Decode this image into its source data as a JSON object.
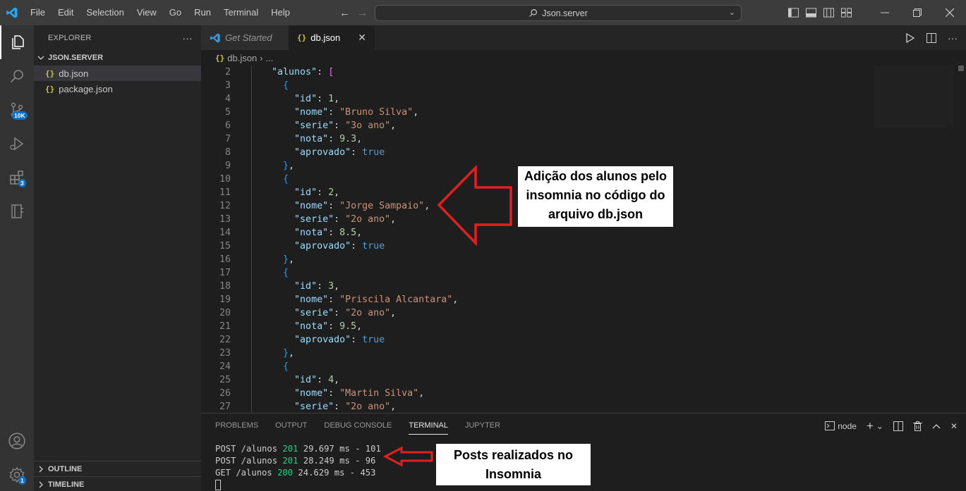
{
  "menu": [
    "File",
    "Edit",
    "Selection",
    "View",
    "Go",
    "Run",
    "Terminal",
    "Help"
  ],
  "command_center": "Json.server",
  "activity": {
    "source_control_badge": "10K",
    "extensions_badge": "3",
    "settings_badge": "1"
  },
  "sidebar": {
    "title": "EXPLORER",
    "more": "···",
    "folder": "JSON.SERVER",
    "files": [
      "db.json",
      "package.json"
    ],
    "outline": "OUTLINE",
    "timeline": "TIMELINE"
  },
  "tabs": {
    "get_started": "Get Started",
    "active": "db.json"
  },
  "breadcrumb": {
    "file": "db.json",
    "rest": "..."
  },
  "code": {
    "line_numbers": [
      "2",
      "3",
      "4",
      "5",
      "6",
      "7",
      "8",
      "9",
      "10",
      "11",
      "12",
      "13",
      "14",
      "15",
      "16",
      "17",
      "18",
      "19",
      "20",
      "21",
      "22",
      "23",
      "24",
      "25",
      "26",
      "27"
    ],
    "students": [
      {
        "id": "1",
        "nome": "\"Bruno Silva\"",
        "serie": "\"3o ano\"",
        "nota": "9.3",
        "aprovado": "true"
      },
      {
        "id": "2",
        "nome": "\"Jorge Sampaio\"",
        "serie": "\"2o ano\"",
        "nota": "8.5",
        "aprovado": "true"
      },
      {
        "id": "3",
        "nome": "\"Priscila Alcantara\"",
        "serie": "\"2o ano\"",
        "nota": "9.5",
        "aprovado": "true"
      },
      {
        "id": "4",
        "nome": "\"Martin Silva\"",
        "serie": "\"2o ano\""
      }
    ]
  },
  "callouts": {
    "top": [
      "Adição dos alunos pelo",
      "insomnia no código do",
      "arquivo db.json"
    ],
    "bottom": [
      "Posts realizados no",
      "Insomnia"
    ]
  },
  "panel": {
    "tabs": [
      "PROBLEMS",
      "OUTPUT",
      "DEBUG CONSOLE",
      "TERMINAL",
      "JUPYTER"
    ],
    "active_tab": "TERMINAL",
    "shell": "node"
  },
  "terminal": [
    {
      "pre": "POST /alunos ",
      "status": "201",
      "post": " 29.697 ms - 101"
    },
    {
      "pre": "POST /alunos ",
      "status": "201",
      "post": " 28.249 ms - 96"
    },
    {
      "pre": "GET /alunos ",
      "status": "200",
      "post": " 24.629 ms - 453"
    }
  ],
  "colors": {
    "accent": "#0e70c0",
    "arrow": "#e02020",
    "string": "#ce9178",
    "key": "#9cdcfe",
    "status_ok": "#23d18b"
  }
}
